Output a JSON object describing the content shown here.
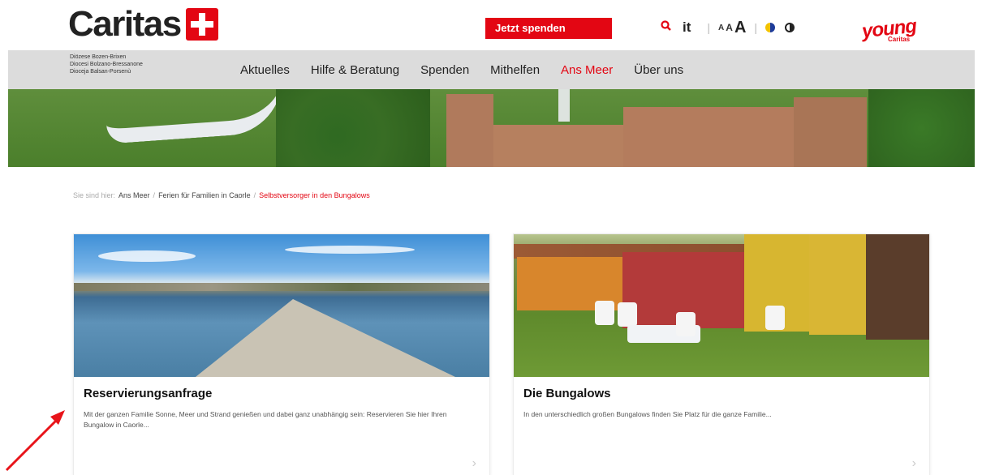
{
  "header": {
    "logo_text": "Caritas",
    "donate_label": "Jetzt spenden",
    "search_icon": "search-icon",
    "lang_label": "it",
    "font_small": "A",
    "font_medium": "A",
    "font_large": "A",
    "young_label": "young",
    "young_sub": "Caritas",
    "colors": {
      "brand": "#e30613"
    }
  },
  "navbar": {
    "diocese_lines": [
      "Diözese Bozen-Brixen",
      "Diocesi Bolzano-Bressanone",
      "Dioceja Balsan-Porsenù"
    ],
    "items": [
      {
        "label": "Aktuelles"
      },
      {
        "label": "Hilfe & Beratung"
      },
      {
        "label": "Spenden"
      },
      {
        "label": "Mithelfen"
      },
      {
        "label": "Ans Meer",
        "active": true
      },
      {
        "label": "Über uns"
      }
    ]
  },
  "breadcrumb": {
    "prefix": "Sie sind hier:",
    "items": [
      "Ans Meer",
      "Ferien für Familien in Caorle"
    ],
    "current": "Selbstversorger in den Bungalows",
    "separator": "/"
  },
  "cards": [
    {
      "title": "Reservierungsanfrage",
      "text": "Mit der ganzen Familie Sonne, Meer und Strand genießen und dabei ganz unabhängig sein: Reservieren Sie hier Ihren Bungalow in Caorle...",
      "arrow": "›"
    },
    {
      "title": "Die Bungalows",
      "text": "In den unterschiedlich großen Bungalows finden Sie Platz für die ganze Familie...",
      "arrow": "›"
    }
  ]
}
